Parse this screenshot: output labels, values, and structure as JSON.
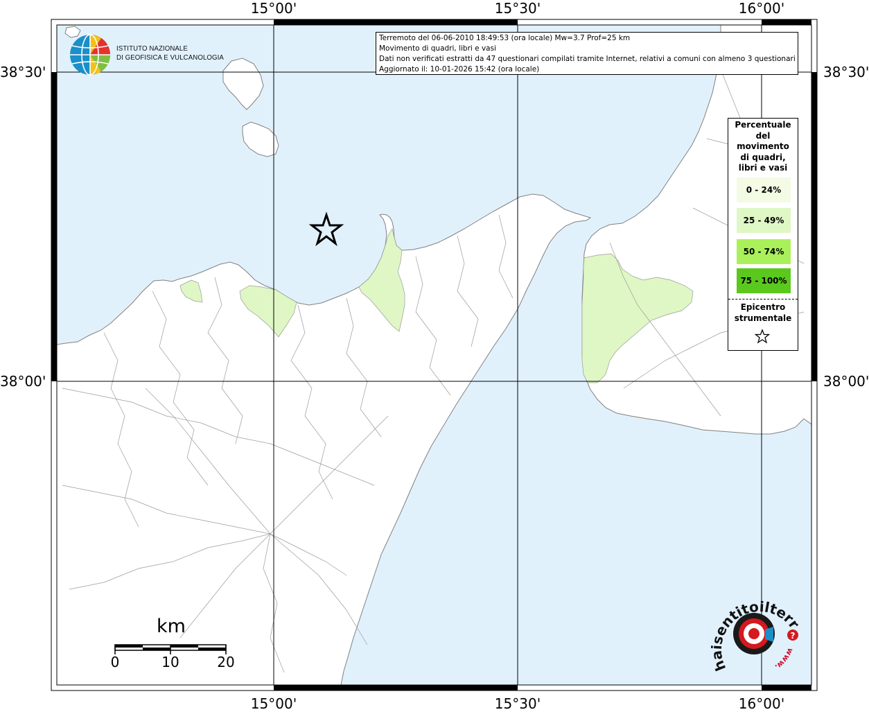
{
  "map": {
    "longitude_labels": [
      "15°00'",
      "15°30'",
      "16°00'"
    ],
    "latitude_labels": [
      "38°30'",
      "38°00'"
    ],
    "colors": {
      "sea": "#e1f1fc",
      "land": "#ffffff",
      "boundaries": "#9a9a9a",
      "graticule": "#000000",
      "class_0_24": "#f3fbe4",
      "class_25_49": "#dff7c4",
      "class_50_74": "#a9f05a",
      "class_75_100": "#5bc81e"
    },
    "epicenter_icon": "star-outline-icon"
  },
  "info": {
    "line1": "Terremoto del 06-06-2010 18:49:53 (ora locale) Mw=3.7 Prof=25 km",
    "line2": "Movimento di quadri, libri e vasi",
    "line3": "Dati non verificati estratti da 47 questionari compilati tramite Internet, relativi a comuni con almeno 3 questionari.",
    "line4": "Aggiornato il: 10-01-2026 15:42 (ora locale)"
  },
  "legend": {
    "title_lines": [
      "Percentuale",
      "del",
      "movimento",
      "di quadri,",
      "libri e vasi"
    ],
    "classes": [
      {
        "label": "0 - 24%",
        "color": "#f3fbe4"
      },
      {
        "label": "25 - 49%",
        "color": "#dff7c4"
      },
      {
        "label": "50 - 74%",
        "color": "#a9f05a"
      },
      {
        "label": "75 - 100%",
        "color": "#5bc81e"
      }
    ],
    "epicenter_lines": [
      "Epicentro",
      "strumentale"
    ]
  },
  "scalebar": {
    "unit": "km",
    "labels": [
      "0",
      "10",
      "20"
    ]
  },
  "logos": {
    "ingv_line1": "ISTITUTO NAZIONALE",
    "ingv_line2": "DI GEOFISICA E VULCANOLOGIA",
    "hst_text": "haisentitoilterremoto.it",
    "hst_www": "www.",
    "hst_question": "?"
  }
}
